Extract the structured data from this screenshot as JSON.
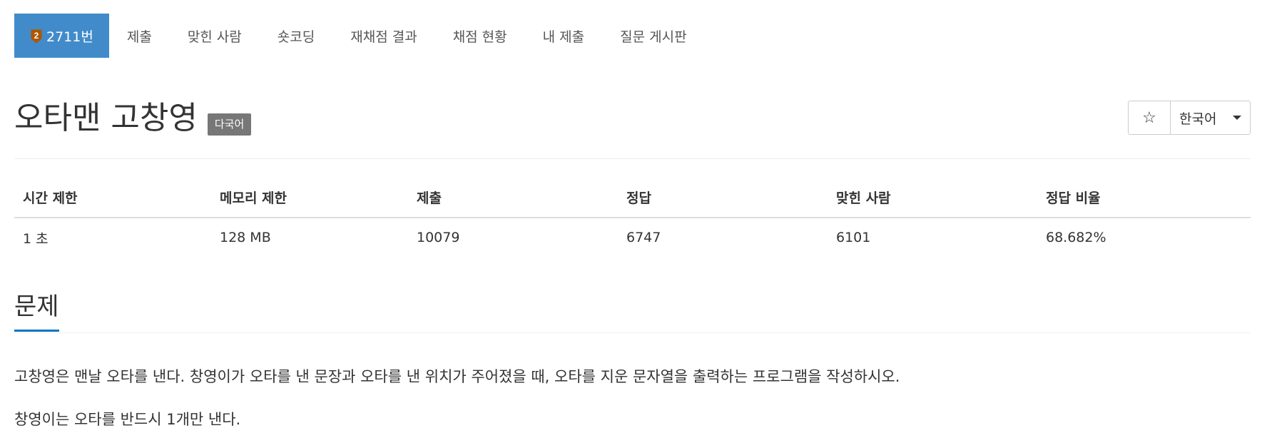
{
  "nav": {
    "tabs": [
      {
        "label": "2711번",
        "active": true,
        "tier_badge": "2"
      },
      {
        "label": "제출"
      },
      {
        "label": "맞힌 사람"
      },
      {
        "label": "숏코딩"
      },
      {
        "label": "재채점 결과"
      },
      {
        "label": "채점 현황"
      },
      {
        "label": "내 제출"
      },
      {
        "label": "질문 게시판"
      }
    ]
  },
  "problem": {
    "title": "오타맨 고창영",
    "label": "다국어"
  },
  "controls": {
    "star_icon": "☆",
    "language": "한국어"
  },
  "stats": {
    "headers": [
      "시간 제한",
      "메모리 제한",
      "제출",
      "정답",
      "맞힌 사람",
      "정답 비율"
    ],
    "values": [
      "1 초",
      "128 MB",
      "10079",
      "6747",
      "6101",
      "68.682%"
    ]
  },
  "section": {
    "title": "문제",
    "paragraphs": [
      "고창영은 맨날 오타를 낸다. 창영이가 오타를 낸 문장과 오타를 낸 위치가 주어졌을 때, 오타를 지운 문자열을 출력하는 프로그램을 작성하시오.",
      "창영이는 오타를 반드시 1개만 낸다."
    ]
  },
  "colors": {
    "active_tab": "#428bca",
    "section_underline": "#0076c0",
    "label_bg": "#777777",
    "tier_badge": "#ad5600"
  }
}
